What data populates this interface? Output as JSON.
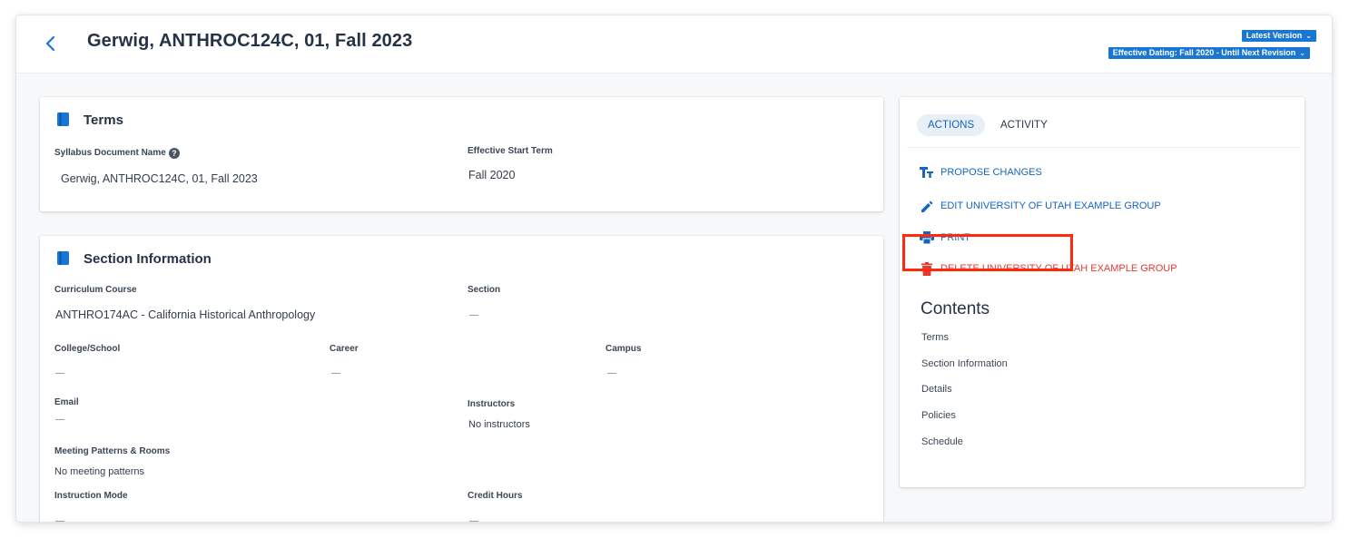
{
  "header": {
    "title": "Gerwig, ANTHROC124C, 01, Fall 2023",
    "version_label": "Latest Version",
    "dating_label": "Effective Dating: Fall 2020 - Until Next Revision"
  },
  "terms": {
    "heading": "Terms",
    "doc_name_label": "Syllabus Document Name",
    "doc_name_value": "Gerwig, ANTHROC124C, 01, Fall 2023",
    "start_term_label": "Effective Start Term",
    "start_term_value": "Fall 2020"
  },
  "section_info": {
    "heading": "Section Information",
    "curriculum_course_label": "Curriculum Course",
    "curriculum_course_value": "ANTHRO174AC - California Historical Anthropology",
    "section_label": "Section",
    "college_label": "College/School",
    "career_label": "Career",
    "campus_label": "Campus",
    "email_label": "Email",
    "instructors_label": "Instructors",
    "instructors_value": "No instructors",
    "meeting_label": "Meeting Patterns & Rooms",
    "meeting_value": "No meeting patterns",
    "instruction_mode_label": "Instruction Mode",
    "credit_hours_label": "Credit Hours"
  },
  "sidebar": {
    "tabs": [
      "ACTIONS",
      "ACTIVITY"
    ],
    "actions": [
      {
        "label": "PROPOSE CHANGES",
        "icon": "text-format-icon"
      },
      {
        "label": "EDIT UNIVERSITY OF UTAH EXAMPLE GROUP",
        "icon": "pencil-icon"
      },
      {
        "label": "PRINT",
        "icon": "printer-icon"
      },
      {
        "label": "DELETE UNIVERSITY OF UTAH EXAMPLE GROUP",
        "icon": "trash-icon"
      }
    ],
    "contents_title": "Contents",
    "contents": [
      "Terms",
      "Section Information",
      "Details",
      "Policies",
      "Schedule"
    ]
  },
  "colors": {
    "accent": "#1976d2",
    "link": "#1565c0",
    "danger": "#e53935",
    "highlight": "#ff2a0a"
  }
}
